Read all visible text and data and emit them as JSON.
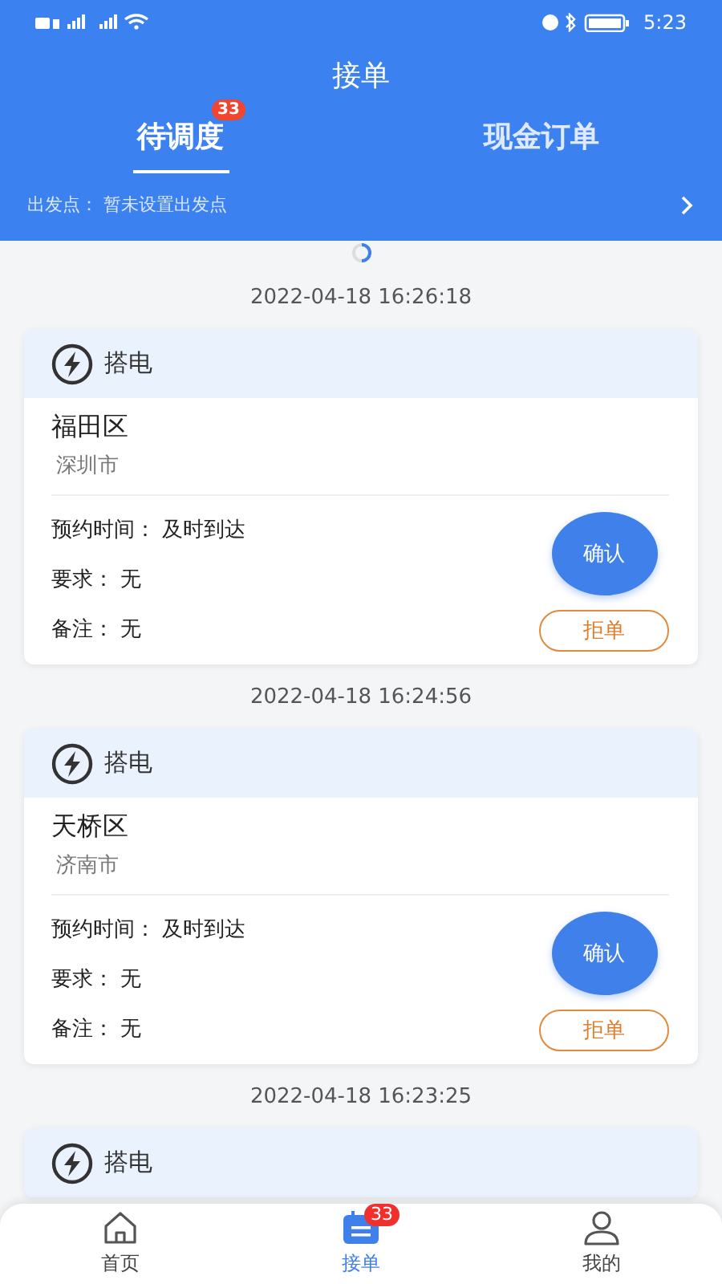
{
  "status_bar": {
    "time": "5:23"
  },
  "header": {
    "title": "接单",
    "tabs": [
      {
        "label": "待调度",
        "badge": "33",
        "selected": true
      },
      {
        "label": "现金订单",
        "selected": false
      }
    ],
    "origin": "出发点：  暂未设置出发点"
  },
  "orders": [
    {
      "time": "2022-04-18 16:26:18",
      "type": "搭电",
      "district": "福田区",
      "city": "深圳市",
      "fields": [
        "预约时间：  及时到达",
        "要求：  无",
        "备注：  无"
      ],
      "confirm": "确认",
      "reject": "拒单"
    },
    {
      "time": "2022-04-18 16:24:56",
      "type": "搭电",
      "district": "天桥区",
      "city": "济南市",
      "fields": [
        "预约时间：  及时到达",
        "要求：  无",
        "备注：  无"
      ],
      "confirm": "确认",
      "reject": "拒单"
    },
    {
      "time": "2022-04-18 16:23:25",
      "type": "搭电"
    }
  ],
  "bottom_nav": [
    {
      "label": "首页",
      "kind": "home",
      "selected": false
    },
    {
      "label": "接单",
      "kind": "orders",
      "badge": "33",
      "selected": true
    },
    {
      "label": "我的",
      "kind": "user",
      "selected": false
    }
  ]
}
